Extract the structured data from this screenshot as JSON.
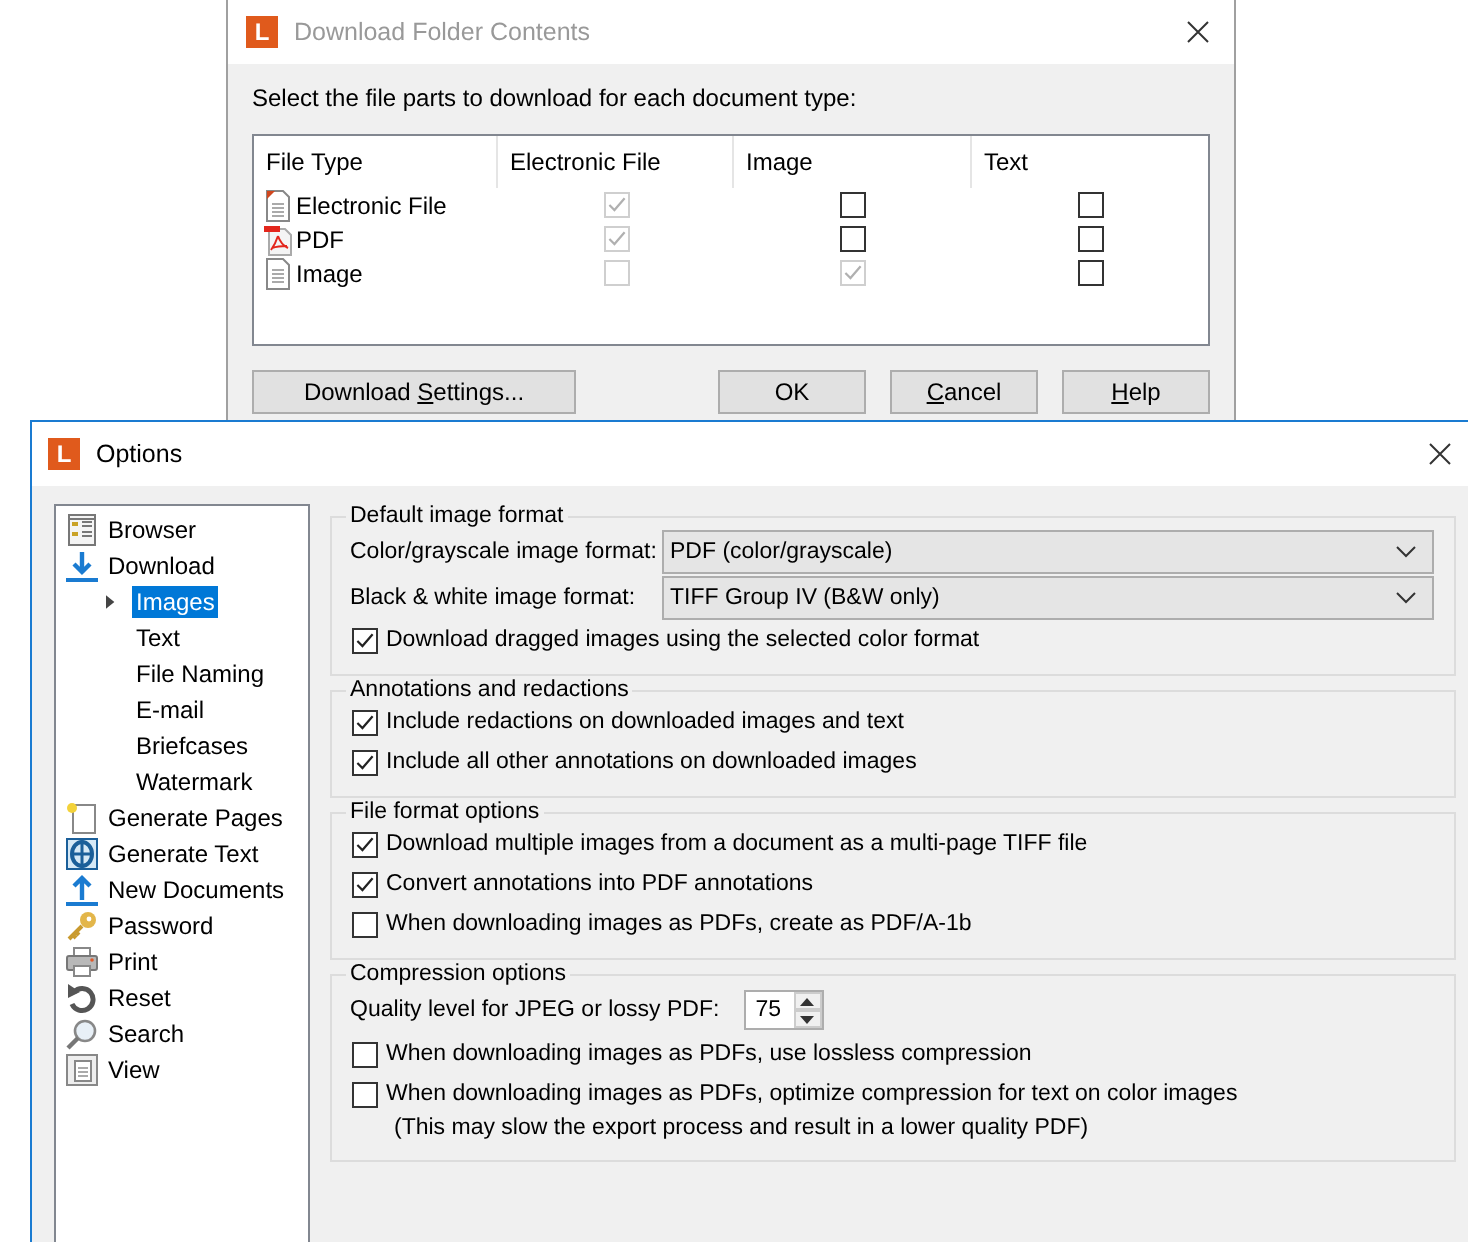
{
  "download_dialog": {
    "logo": "L",
    "title": "Download Folder Contents",
    "instruction": "Select the file parts to download for each document type:",
    "table": {
      "columns": [
        "File Type",
        "Electronic File",
        "Image",
        "Text"
      ],
      "rows": [
        {
          "kind": "document",
          "name": "Electronic File",
          "cells": [
            {
              "checked": true,
              "disabled": true
            },
            {
              "checked": false,
              "disabled": false
            },
            {
              "checked": false,
              "disabled": false
            }
          ]
        },
        {
          "kind": "pdf",
          "name": "PDF",
          "cells": [
            {
              "checked": true,
              "disabled": true
            },
            {
              "checked": false,
              "disabled": false
            },
            {
              "checked": false,
              "disabled": false
            }
          ]
        },
        {
          "kind": "image",
          "name": "Image",
          "cells": [
            {
              "checked": false,
              "disabled": true
            },
            {
              "checked": true,
              "disabled": true
            },
            {
              "checked": false,
              "disabled": false
            }
          ]
        }
      ]
    },
    "buttons": [
      {
        "label_start": "Download ",
        "mnemonic": "S",
        "label_end": "ettings..."
      },
      {
        "label_start": "OK"
      },
      {
        "mnemonic": "C",
        "label_end": "ancel"
      },
      {
        "mnemonic": "H",
        "label_end": "elp"
      }
    ]
  },
  "options_window": {
    "logo": "L",
    "title": "Options",
    "tree": [
      {
        "kind": "browser",
        "label": "Browser",
        "selected": false
      },
      {
        "kind": "download",
        "label": "Download",
        "selected": false,
        "children": [
          {
            "label": "Images",
            "selected": true,
            "expanded": false
          },
          {
            "label": "Text",
            "selected": false
          },
          {
            "label": "File Naming",
            "selected": false
          },
          {
            "label": "E-mail",
            "selected": false
          },
          {
            "label": "Briefcases",
            "selected": false
          },
          {
            "label": "Watermark",
            "selected": false
          }
        ]
      },
      {
        "kind": "generate-pages",
        "label": "Generate Pages",
        "selected": false
      },
      {
        "kind": "generate-text",
        "label": "Generate Text",
        "selected": false
      },
      {
        "kind": "new-documents",
        "label": "New Documents",
        "selected": false
      },
      {
        "kind": "password",
        "label": "Password",
        "selected": false
      },
      {
        "kind": "print",
        "label": "Print",
        "selected": false
      },
      {
        "kind": "reset",
        "label": "Reset",
        "selected": false
      },
      {
        "kind": "search",
        "label": "Search",
        "selected": false
      },
      {
        "kind": "view",
        "label": "View",
        "selected": false
      }
    ],
    "groups": [
      {
        "title": "Default image format",
        "rows": [
          {
            "kind": "select",
            "label": "Color/grayscale image format:",
            "value": "PDF (color/grayscale)"
          },
          {
            "kind": "select",
            "label": "Black & white image format:",
            "value": "TIFF Group IV (B&W only)"
          },
          {
            "kind": "checkbox",
            "label": "Download dragged images using the selected color format",
            "checked": true
          }
        ]
      },
      {
        "title": "Annotations and redactions",
        "rows": [
          {
            "kind": "checkbox",
            "label": "Include redactions on downloaded images and text",
            "checked": true
          },
          {
            "kind": "checkbox",
            "label": "Include all other annotations on downloaded images",
            "checked": true
          }
        ]
      },
      {
        "title": "File format options",
        "rows": [
          {
            "kind": "checkbox",
            "label": "Download multiple images from a document as a multi-page TIFF file",
            "checked": true
          },
          {
            "kind": "checkbox",
            "label": "Convert annotations into PDF annotations",
            "checked": true
          },
          {
            "kind": "checkbox",
            "label": "When downloading images as PDFs, create as PDF/A-1b",
            "checked": false
          }
        ]
      },
      {
        "title": "Compression options",
        "rows": [
          {
            "kind": "spinner",
            "label": "Quality level for JPEG or lossy PDF:",
            "value": "75"
          },
          {
            "kind": "checkbox",
            "label": "When downloading images as PDFs, use lossless compression",
            "checked": false
          },
          {
            "kind": "checkbox",
            "label": "When downloading images as PDFs, optimize compression for text on color images",
            "checked": false,
            "note": "(This may slow the export process and result in a lower quality PDF)"
          }
        ]
      }
    ]
  }
}
